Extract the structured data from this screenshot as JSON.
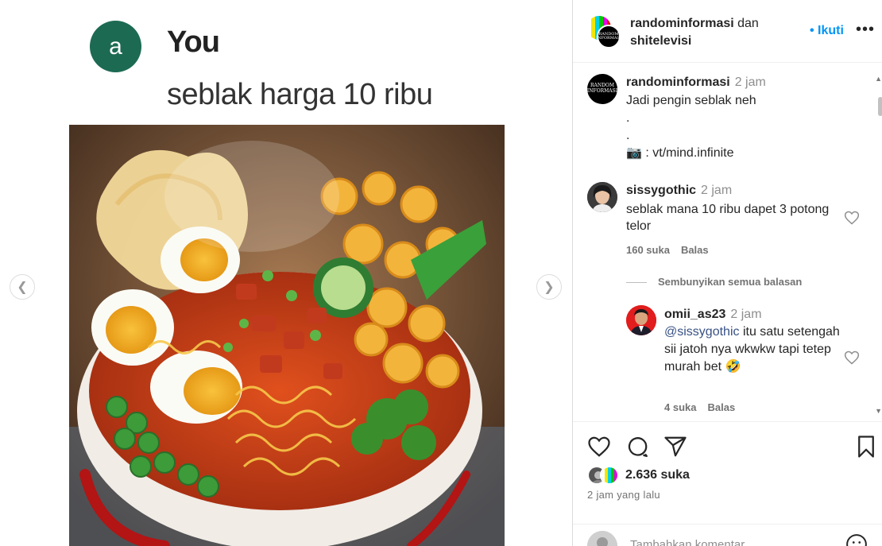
{
  "post_image": {
    "chat_avatar_letter": "a",
    "chat_user": "You",
    "chat_message": "seblak harga 10 ribu",
    "image_alt": "Bowl of seblak with noodles, eggs, crackers and vegetables"
  },
  "header": {
    "account_1": "randominformasi",
    "connector": " dan ",
    "account_2": "shitelevisi",
    "follow_label": "• Ikuti",
    "more_icon": "more-horizontal-icon"
  },
  "caption": {
    "username": "randominformasi",
    "time": "2 jam",
    "lines": [
      "Jadi pengin seblak neh",
      ".",
      ".",
      "📷 : vt/mind.infinite"
    ]
  },
  "comments": [
    {
      "username": "sissygothic",
      "time": "2 jam",
      "text": "seblak mana 10 ribu dapet 3 potong telor",
      "likes": "160 suka",
      "reply_label": "Balas"
    }
  ],
  "hide_replies_label": "Sembunyikan semua balasan",
  "replies": [
    {
      "username": "omii_as23",
      "time": "2 jam",
      "mention": "@sissygothic",
      "text": " itu satu setengah sii jatoh nya wkwkw tapi tetep murah bet 🤣",
      "likes": "4 suka",
      "reply_label": "Balas"
    }
  ],
  "footer": {
    "likes_count": "2.636 suka",
    "post_time": "2 jam yang lalu",
    "add_comment_placeholder": "Tambahkan komentar..."
  },
  "avatar_logo_text": "RANDOM INFORMASI",
  "colors": {
    "link_blue": "#0095f6",
    "chat_avatar": "#1d6a53",
    "muted_text": "#8e8e8e"
  }
}
